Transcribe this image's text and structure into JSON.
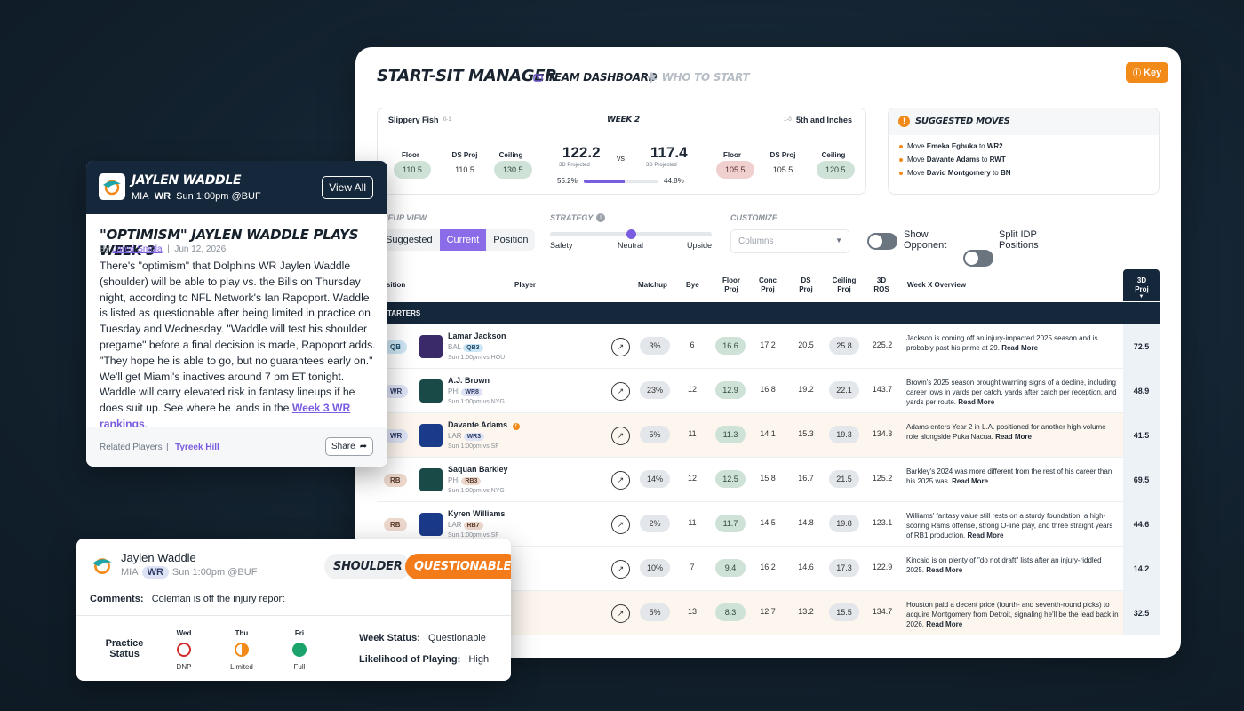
{
  "main": {
    "title": "START-SIT MANAGER",
    "tabs": [
      {
        "label": "TEAM DASHBOARD",
        "icon": "dashboard-icon",
        "active": true
      },
      {
        "label": "WHO TO START",
        "icon": "runner-icon",
        "active": false
      }
    ],
    "key_label": "Key",
    "matchup": {
      "team_left": "Slippery Fish",
      "record_left": "0-1",
      "week": "WEEK 2",
      "record_right": "1-0",
      "team_right": "5th and Inches",
      "left": {
        "floor_label": "Floor",
        "floor": "110.5",
        "ds_label": "DS Proj",
        "ds": "110.5",
        "ceiling_label": "Ceiling",
        "ceiling": "130.5",
        "projected": "122.2",
        "projected_label": "3D Projected",
        "win_pct": "55.2%"
      },
      "vs": "vs",
      "right": {
        "floor_label": "Floor",
        "floor": "105.5",
        "ds_label": "DS Proj",
        "ds": "105.5",
        "ceiling_label": "Ceiling",
        "ceiling": "120.5",
        "projected": "117.4",
        "projected_label": "3D Projected",
        "win_pct": "44.8%"
      },
      "win_fraction_left": 0.552
    },
    "suggested": {
      "title": "SUGGESTED MOVES",
      "moves": [
        {
          "pre": "Move ",
          "player": "Emeka Egbuka",
          "mid": " to ",
          "slot": "WR2"
        },
        {
          "pre": "Move ",
          "player": "Davante Adams",
          "mid": " to ",
          "slot": "RWT"
        },
        {
          "pre": "Move ",
          "player": "David Montgomery",
          "mid": " to ",
          "slot": "BN"
        }
      ]
    },
    "controls": {
      "lineup_view_label": "NEUP VIEW",
      "lineup_options": [
        "Suggested",
        "Current",
        "Position"
      ],
      "lineup_selected": "Current",
      "strategy_label": "STRATEGY",
      "strategy_options": [
        "Safety",
        "Neutral",
        "Upside"
      ],
      "strategy_value": 0.5,
      "customize_label": "CUSTOMIZE",
      "columns_placeholder": "Columns",
      "show_opponent": "Show Opponent",
      "split_idp": "Split IDP Positions"
    },
    "table": {
      "headers": {
        "position": "osition",
        "player": "Player",
        "matchup": "Matchup",
        "bye": "Bye",
        "floor": "Floor Proj",
        "conc": "Conc Proj",
        "ds": "DS Proj",
        "ceiling": "Ceiling Proj",
        "ros": "3D ROS",
        "overview": "Week X Overview",
        "proj": "3D Proj"
      },
      "section": "TARTERS",
      "rows": [
        {
          "pos": "QB",
          "name": "Lamar Jackson",
          "team": "BAL",
          "rank": "QB3",
          "game": "Sun 1:00pm vs HOU",
          "matchup": "3%",
          "bye": "6",
          "floor": "16.6",
          "conc": "17.2",
          "ds": "20.5",
          "ceiling": "25.8",
          "ros": "225.2",
          "overview": "Jackson is coming off an injury-impacted 2025 season and is probably past his prime at 29.",
          "read_more": "Read More",
          "proj": "72.5"
        },
        {
          "pos": "WR",
          "name": "A.J. Brown",
          "team": "PHI",
          "rank": "WR8",
          "game": "Sun 1:00pm vs NYG",
          "matchup": "23%",
          "bye": "12",
          "floor": "12.9",
          "conc": "16.8",
          "ds": "19.2",
          "ceiling": "22.1",
          "ros": "143.7",
          "overview": "Brown's 2025 season brought warning signs of a decline, including career lows in yards per catch, yards after catch per reception, and yards per route.",
          "read_more": "Read More",
          "proj": "48.9"
        },
        {
          "pos": "WR",
          "name": "Davante Adams",
          "team": "LAR",
          "rank": "WR3",
          "game": "Sun 1:00pm vs SF",
          "matchup": "5%",
          "bye": "11",
          "floor": "11.3",
          "conc": "14.1",
          "ds": "15.3",
          "ceiling": "19.3",
          "ros": "134.3",
          "overview": "Adams enters Year 2 in L.A. positioned for another high-volume role alongside Puka Nacua.",
          "read_more": "Read More",
          "proj": "41.5"
        },
        {
          "pos": "RB",
          "name": "Saquan Barkley",
          "team": "PHI",
          "rank": "RB3",
          "game": "Sun 1:00pm vs NYG",
          "matchup": "14%",
          "bye": "12",
          "floor": "12.5",
          "conc": "15.8",
          "ds": "16.7",
          "ceiling": "21.5",
          "ros": "125.2",
          "overview": "Barkley's 2024 was more different from the rest of his career than his 2025 was.",
          "read_more": "Read More",
          "proj": "69.5"
        },
        {
          "pos": "RB",
          "name": "Kyren Williams",
          "team": "LAR",
          "rank": "RB7",
          "game": "Sun 1:00pm vs SF",
          "matchup": "2%",
          "bye": "11",
          "floor": "11.7",
          "conc": "14.5",
          "ds": "14.8",
          "ceiling": "19.8",
          "ros": "123.1",
          "overview": "Williams' fantasy value still rests on a sturdy foundation: a high-scoring Rams offense, strong O-line play, and three straight years of RB1 production.",
          "read_more": "Read More",
          "proj": "44.6"
        },
        {
          "pos": "",
          "name": "",
          "team": "",
          "rank": "",
          "game": "",
          "matchup": "10%",
          "bye": "7",
          "floor": "9.4",
          "conc": "16.2",
          "ds": "14.6",
          "ceiling": "17.3",
          "ros": "122.9",
          "overview": "Kincaid is on plenty of \"do not draft\" lists after an injury-riddled 2025.",
          "read_more": "Read More",
          "proj": "14.2"
        },
        {
          "pos": "",
          "name": "ery",
          "team": "",
          "rank": "",
          "game": "",
          "matchup": "5%",
          "bye": "13",
          "floor": "8.3",
          "conc": "12.7",
          "ds": "13.2",
          "ceiling": "15.5",
          "ros": "134.7",
          "overview": "Houston paid a decent price (fourth- and seventh-round picks) to acquire Montgomery from Detroit, signaling he'll be the lead back in 2026.",
          "read_more": "Read More",
          "proj": "32.5"
        }
      ]
    }
  },
  "article": {
    "player": "JAYLEN WADDLE",
    "team": "MIA",
    "pos": "WR",
    "game": "Sun 1:00pm @BUF",
    "view_all": "View All",
    "headline": "\"OPTIMISM\" JAYLEN WADDLE PLAYS WEEK 3",
    "by": "By",
    "author": "Jared Smola",
    "date": "Jun 12, 2026",
    "body": "There's \"optimism\" that Dolphins WR Jaylen Waddle (shoulder) will be able to play vs. the Bills on Thursday night, according to NFL Network's Ian Rapoport. Waddle is listed as questionable after being limited in practice on Tuesday and Wednesday. \"Waddle will test his shoulder pregame\" before a final decision is made, Rapoport adds. \"They hope he is able to go, but no guarantees early on.\" We'll get Miami's inactives around 7 pm ET tonight. Waddle will carry elevated risk in fantasy lineups if he does suit up. See where he lands in the ",
    "body_link": "Week 3 WR rankings",
    "body_end": ".",
    "related_label": "Related Players",
    "related_sep": "|",
    "related_player": "Tyreek Hill",
    "share": "Share"
  },
  "injury": {
    "player": "Jaylen Waddle",
    "team": "MIA",
    "pos": "WR",
    "game": "Sun 1:00pm @BUF",
    "injury_tag": "SHOULDER",
    "status_tag": "QUESTIONABLE",
    "comments_label": "Comments:",
    "comments": "Coleman is off the injury report",
    "practice_label": "Practice Status",
    "days": [
      {
        "day": "Wed",
        "status": "DNP"
      },
      {
        "day": "Thu",
        "status": "Limited"
      },
      {
        "day": "Fri",
        "status": "Full"
      }
    ],
    "week_status_label": "Week Status:",
    "week_status": "Questionable",
    "likelihood_label": "Likelihood of Playing:",
    "likelihood": "High"
  },
  "colors": {
    "accent": "#8a6be8",
    "orange": "#f28a1a",
    "navy": "#15273a",
    "green": "#1aa36b",
    "red": "#d12a2a"
  }
}
